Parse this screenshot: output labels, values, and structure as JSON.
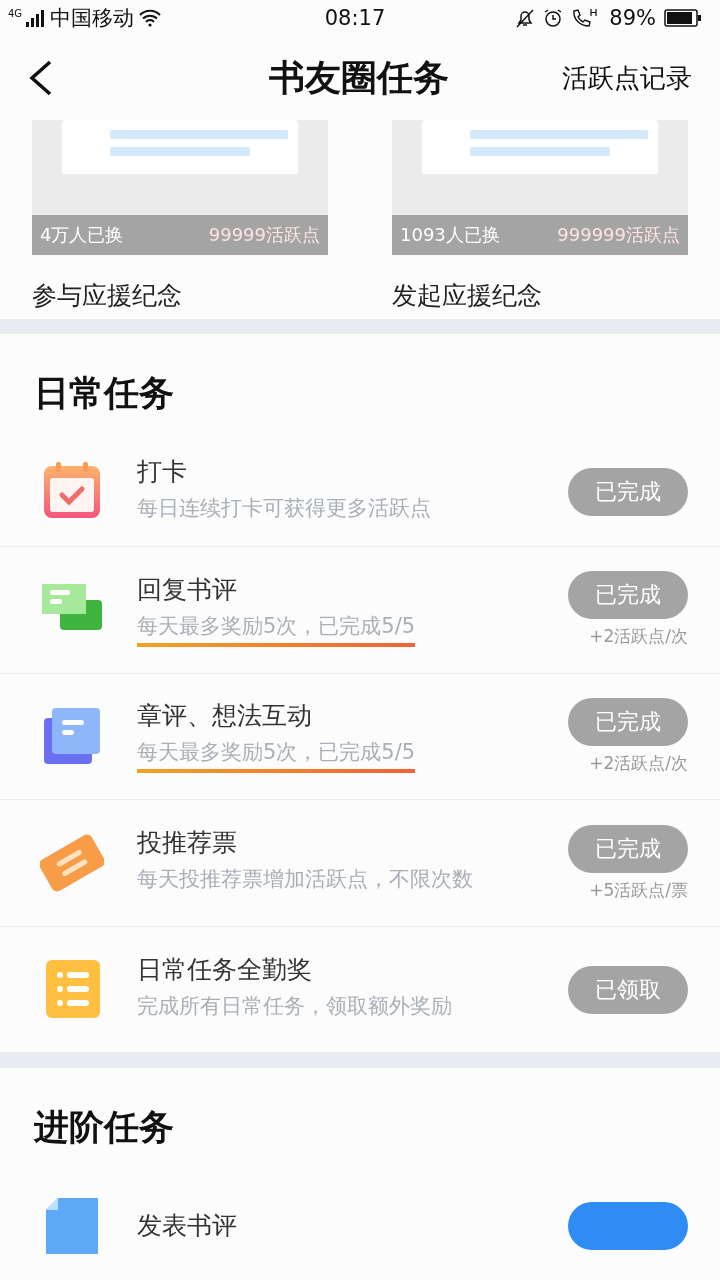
{
  "status_bar": {
    "network": "4G",
    "carrier": "中国移动",
    "time": "08:17",
    "battery": "89%"
  },
  "nav": {
    "title": "书友圈任务",
    "action": "活跃点记录"
  },
  "rewards": [
    {
      "count": "4万人已换",
      "price": "99999活跃点",
      "name": "参与应援纪念",
      "kind": "picture"
    },
    {
      "count": "1093人已换",
      "price": "999999活跃点",
      "name": "发起应援纪念",
      "kind": "picture"
    }
  ],
  "sections": [
    {
      "title": "日常任务",
      "tasks": [
        {
          "kind": "calendar",
          "title": "打卡",
          "desc": "每日连续打卡可获得更多活跃点",
          "highlighted": false,
          "button": "已完成",
          "done": true
        },
        {
          "kind": "chat",
          "title": "回复书评",
          "desc": "每天最多奖励5次，已完成5/5",
          "highlighted": true,
          "button": "已完成",
          "done": true,
          "reward": "+2活跃点/次"
        },
        {
          "kind": "note",
          "title": "章评、想法互动",
          "desc": "每天最多奖励5次，已完成5/5",
          "highlighted": true,
          "button": "已完成",
          "done": true,
          "reward": "+2活跃点/次"
        },
        {
          "kind": "ticket",
          "title": "投推荐票",
          "desc": "每天投推荐票增加活跃点，不限次数",
          "highlighted": false,
          "button": "已完成",
          "done": true,
          "reward": "+5活跃点/票"
        },
        {
          "kind": "list",
          "title": "日常任务全勤奖",
          "desc": "完成所有日常任务，领取额外奖励",
          "highlighted": false,
          "button": "已领取",
          "done": true
        }
      ]
    },
    {
      "title": "进阶任务",
      "tasks": [
        {
          "kind": "doc",
          "title": "发表书评",
          "done": false
        }
      ]
    }
  ]
}
